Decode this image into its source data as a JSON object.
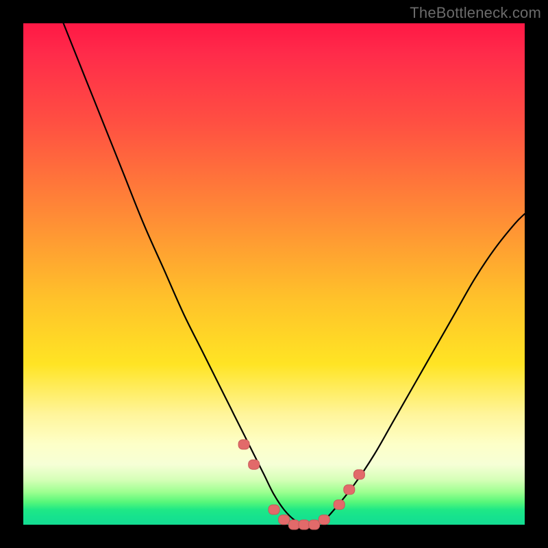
{
  "watermark": "TheBottleneck.com",
  "colors": {
    "background": "#000000",
    "curve": "#000000",
    "marker_fill": "#e26a6a",
    "marker_stroke": "#c65a5a"
  },
  "chart_data": {
    "type": "line",
    "title": "",
    "xlabel": "",
    "ylabel": "",
    "xlim": [
      0,
      100
    ],
    "ylim": [
      0,
      100
    ],
    "grid": false,
    "legend": false,
    "series": [
      {
        "name": "bottleneck-curve",
        "x": [
          8,
          12,
          16,
          20,
          24,
          28,
          32,
          36,
          40,
          42,
          44,
          46,
          48,
          50,
          52,
          54,
          56,
          58,
          60,
          62,
          66,
          70,
          74,
          78,
          82,
          86,
          90,
          94,
          98,
          100
        ],
        "y": [
          100,
          90,
          80,
          70,
          60,
          51,
          42,
          34,
          26,
          22,
          18,
          14,
          10,
          6,
          3,
          1,
          0,
          0,
          1,
          3,
          8,
          14,
          21,
          28,
          35,
          42,
          49,
          55,
          60,
          62
        ]
      }
    ],
    "markers": [
      {
        "x": 44,
        "y": 16
      },
      {
        "x": 46,
        "y": 12
      },
      {
        "x": 50,
        "y": 3
      },
      {
        "x": 52,
        "y": 1
      },
      {
        "x": 54,
        "y": 0
      },
      {
        "x": 56,
        "y": 0
      },
      {
        "x": 58,
        "y": 0
      },
      {
        "x": 60,
        "y": 1
      },
      {
        "x": 63,
        "y": 4
      },
      {
        "x": 65,
        "y": 7
      },
      {
        "x": 67,
        "y": 10
      }
    ],
    "gradient_stops": [
      {
        "pos": 0.0,
        "color": "#ff1845"
      },
      {
        "pos": 0.38,
        "color": "#ff8a36"
      },
      {
        "pos": 0.68,
        "color": "#ffe424"
      },
      {
        "pos": 0.88,
        "color": "#f6ffd6"
      },
      {
        "pos": 1.0,
        "color": "#14dd92"
      }
    ]
  }
}
